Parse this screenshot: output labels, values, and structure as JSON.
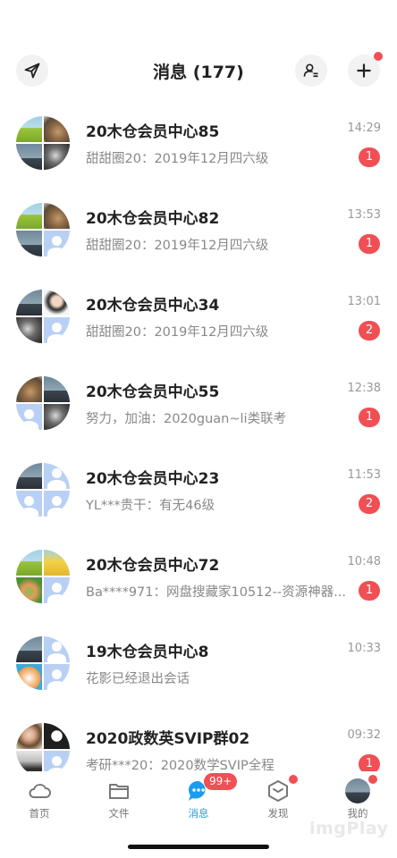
{
  "header": {
    "title": "消息 (177)",
    "send_icon": "paper-plane-icon",
    "contacts_icon": "contacts-icon",
    "add_icon": "plus-icon"
  },
  "conversations": [
    {
      "name": "20木仓会员中心85",
      "preview": "甜甜圈20：2019年12月四六级",
      "time": "14:29",
      "badge": "1",
      "tiles": [
        "scenic",
        "squirrel",
        "tower",
        "tunnel"
      ]
    },
    {
      "name": "20木仓会员中心82",
      "preview": "甜甜圈20：2019年12月四六级",
      "time": "13:53",
      "badge": "1",
      "tiles": [
        "scenic",
        "squirrel",
        "tower",
        "default"
      ]
    },
    {
      "name": "20木仓会员中心34",
      "preview": "甜甜圈20：2019年12月四六级",
      "time": "13:01",
      "badge": "2",
      "tiles": [
        "tower",
        "girl",
        "tunnel",
        "default"
      ]
    },
    {
      "name": "20木仓会员中心55",
      "preview": "努力，加油：2020guan~li类联考",
      "time": "12:38",
      "badge": "1",
      "tiles": [
        "squirrel",
        "tower",
        "default",
        "tunnel"
      ]
    },
    {
      "name": "20木仓会员中心23",
      "preview": "YL***贵干：有无46级",
      "time": "11:53",
      "badge": "2",
      "tiles": [
        "tower",
        "default",
        "default",
        "default"
      ]
    },
    {
      "name": "20木仓会员中心72",
      "preview": "Ba****971：网盘搜藏家10512--资源神器...",
      "time": "10:48",
      "badge": "1",
      "tiles": [
        "scenic",
        "yellow",
        "cartoon",
        "default"
      ]
    },
    {
      "name": "19木仓会员中心8",
      "preview": "花影已经退出会话",
      "time": "10:33",
      "badge": "",
      "tiles": [
        "tower",
        "default",
        "cat",
        "default"
      ]
    },
    {
      "name": "2020政数英SVIP群02",
      "preview": "考研***20：2020数学SVIP全程",
      "time": "09:32",
      "badge": "1",
      "tiles": [
        "face",
        "logo",
        "person",
        "default"
      ]
    }
  ],
  "tabbar": {
    "tabs": [
      {
        "label": "首页",
        "icon": "cloud-icon"
      },
      {
        "label": "文件",
        "icon": "folder-icon"
      },
      {
        "label": "消息",
        "icon": "chat-bubble-icon",
        "badge": "99+"
      },
      {
        "label": "发现",
        "icon": "cube-icon"
      },
      {
        "label": "我的",
        "icon": "user-avatar"
      }
    ]
  },
  "watermark": "imgPlay",
  "colors": {
    "accent": "#1a9df0",
    "badge": "#f04f54"
  }
}
